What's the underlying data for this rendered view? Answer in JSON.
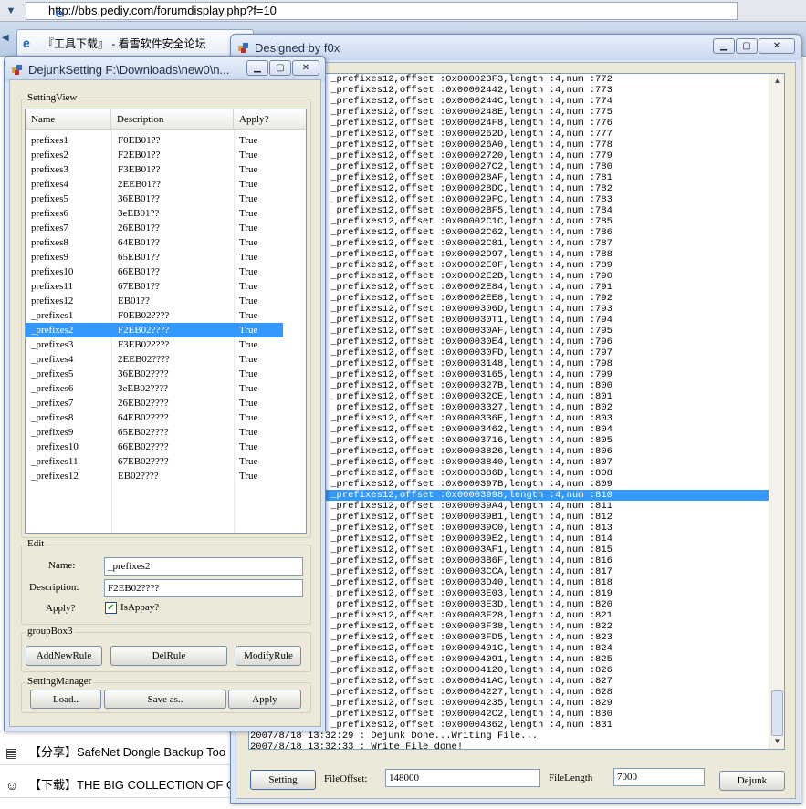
{
  "browser": {
    "url": "http://bbs.pediy.com/forumdisplay.php?f=10",
    "tab_title": "『工具下载』 - 看雪软件安全论坛",
    "rows": [
      {
        "icon": "document-icon",
        "text": "【分享】SafeNet Dongle Backup Too"
      },
      {
        "icon": "smiley-icon",
        "text": "【下载】THE BIG COLLECTION OF O"
      }
    ]
  },
  "main_window": {
    "title": "Designed by f0x",
    "log_lines": [
      "2:29 : Name : _prefixes12,offset :0x000023F3,length :4,num :772",
      "2:29 : Name : _prefixes12,offset :0x00002442,length :4,num :773",
      "2:29 : Name : _prefixes12,offset :0x0000244C,length :4,num :774",
      "2:29 : Name : _prefixes12,offset :0x0000248E,length :4,num :775",
      "2:29 : Name : _prefixes12,offset :0x000024F8,length :4,num :776",
      "2:29 : Name : _prefixes12,offset :0x0000262D,length :4,num :777",
      "2:29 : Name : _prefixes12,offset :0x000026A0,length :4,num :778",
      "2:29 : Name : _prefixes12,offset :0x00002720,length :4,num :779",
      "2:29 : Name : _prefixes12,offset :0x000027C2,length :4,num :780",
      "2:29 : Name : _prefixes12,offset :0x000028AF,length :4,num :781",
      "2:29 : Name : _prefixes12,offset :0x000028DC,length :4,num :782",
      "2:29 : Name : _prefixes12,offset :0x000029FC,length :4,num :783",
      "2:29 : Name : _prefixes12,offset :0x00002BF5,length :4,num :784",
      "2:29 : Name : _prefixes12,offset :0x00002C1C,length :4,num :785",
      "2:29 : Name : _prefixes12,offset :0x00002C62,length :4,num :786",
      "2:29 : Name : _prefixes12,offset :0x00002C81,length :4,num :787",
      "2:29 : Name : _prefixes12,offset :0x00002D97,length :4,num :788",
      "2:29 : Name : _prefixes12,offset :0x00002E0F,length :4,num :789",
      "2:29 : Name : _prefixes12,offset :0x00002E2B,length :4,num :790",
      "2:29 : Name : _prefixes12,offset :0x00002E84,length :4,num :791",
      "2:29 : Name : _prefixes12,offset :0x00002EE8,length :4,num :792",
      "2:29 : Name : _prefixes12,offset :0x0000306D,length :4,num :793",
      "2:29 : Name : _prefixes12,offset :0x000030T1,length :4,num :794",
      "2:29 : Name : _prefixes12,offset :0x000030AF,length :4,num :795",
      "2:29 : Name : _prefixes12,offset :0x000030E4,length :4,num :796",
      "2:29 : Name : _prefixes12,offset :0x000030FD,length :4,num :797",
      "2:29 : Name : _prefixes12,offset :0x00003148,length :4,num :798",
      "2:29 : Name : _prefixes12,offset :0x00003165,length :4,num :799",
      "2:29 : Name : _prefixes12,offset :0x0000327B,length :4,num :800",
      "2:29 : Name : _prefixes12,offset :0x000032CE,length :4,num :801",
      "2:29 : Name : _prefixes12,offset :0x00003327,length :4,num :802",
      "2:29 : Name : _prefixes12,offset :0x0000336E,length :4,num :803",
      "2:29 : Name : _prefixes12,offset :0x00003462,length :4,num :804",
      "2:29 : Name : _prefixes12,offset :0x00003716,length :4,num :805",
      "2:29 : Name : _prefixes12,offset :0x00003826,length :4,num :806",
      "2:29 : Name : _prefixes12,offset :0x00003840,length :4,num :807",
      "2:29 : Name : _prefixes12,offset :0x0000386D,length :4,num :808",
      "2:29 : Name : _prefixes12,offset :0x0000397B,length :4,num :809",
      "2:29 : Name : _prefixes12,offset :0x00003998,length :4,num :810",
      "2:29 : Name : _prefixes12,offset :0x000039A4,length :4,num :811",
      "2:29 : Name : _prefixes12,offset :0x000039B1,length :4,num :812",
      "2:29 : Name : _prefixes12,offset :0x000039C0,length :4,num :813",
      "2:29 : Name : _prefixes12,offset :0x000039E2,length :4,num :814",
      "2:29 : Name : _prefixes12,offset :0x00003AF1,length :4,num :815",
      "2:29 : Name : _prefixes12,offset :0x00003B6F,length :4,num :816",
      "2:29 : Name : _prefixes12,offset :0x00003CCA,length :4,num :817",
      "2:29 : Name : _prefixes12,offset :0x00003D40,length :4,num :818",
      "2:29 : Name : _prefixes12,offset :0x00003E03,length :4,num :819",
      "2:29 : Name : _prefixes12,offset :0x00003E3D,length :4,num :820",
      "2:29 : Name : _prefixes12,offset :0x00003F28,length :4,num :821",
      "2:29 : Name : _prefixes12,offset :0x00003F38,length :4,num :822",
      "2:29 : Name : _prefixes12,offset :0x00003FD5,length :4,num :823",
      "2:29 : Name : _prefixes12,offset :0x0000401C,length :4,num :824",
      "2:29 : Name : _prefixes12,offset :0x00004091,length :4,num :825",
      "2:29 : Name : _prefixes12,offset :0x00004120,length :4,num :826",
      "2:29 : Name : _prefixes12,offset :0x000041AC,length :4,num :827",
      "2:29 : Name : _prefixes12,offset :0x00004227,length :4,num :828",
      "2:29 : Name : _prefixes12,offset :0x00004235,length :4,num :829",
      "2:29 : Name : _prefixes12,offset :0x000042C2,length :4,num :830",
      "2:29 : Name : _prefixes12,offset :0x00004362,length :4,num :831",
      "2007/8/18 13:32:29 : Dejunk Done...Writing File...",
      "2007/8/18 13:32:33 : Write File done!"
    ],
    "selected_log_index": 38,
    "setting_button": "Setting",
    "file_offset_label": "FileOffset:",
    "file_offset_value": "148000",
    "file_length_label": "FileLength",
    "file_length_value": "7000",
    "dejunk_button": "Dejunk"
  },
  "setting_window": {
    "title": "DejunkSetting F:\\Downloads\\new0\\n...",
    "group_title": "SettingView",
    "columns": [
      "Name",
      "Description",
      "Apply?"
    ],
    "rows": [
      {
        "name": "prefixes1",
        "desc": "F0EB01??",
        "apply": "True"
      },
      {
        "name": "prefixes2",
        "desc": "F2EB01??",
        "apply": "True"
      },
      {
        "name": "prefixes3",
        "desc": "F3EB01??",
        "apply": "True"
      },
      {
        "name": "prefixes4",
        "desc": "2EEB01??",
        "apply": "True"
      },
      {
        "name": "prefixes5",
        "desc": "36EB01??",
        "apply": "True"
      },
      {
        "name": "prefixes6",
        "desc": "3eEB01??",
        "apply": "True"
      },
      {
        "name": "prefixes7",
        "desc": "26EB01??",
        "apply": "True"
      },
      {
        "name": "prefixes8",
        "desc": "64EB01??",
        "apply": "True"
      },
      {
        "name": "prefixes9",
        "desc": "65EB01??",
        "apply": "True"
      },
      {
        "name": "prefixes10",
        "desc": "66EB01??",
        "apply": "True"
      },
      {
        "name": "prefixes11",
        "desc": "67EB01??",
        "apply": "True"
      },
      {
        "name": "prefixes12",
        "desc": "EB01??",
        "apply": "True"
      },
      {
        "name": "_prefixes1",
        "desc": "F0EB02????",
        "apply": "True"
      },
      {
        "name": "_prefixes2",
        "desc": "F2EB02????",
        "apply": "True"
      },
      {
        "name": "_prefixes3",
        "desc": "F3EB02????",
        "apply": "True"
      },
      {
        "name": "_prefixes4",
        "desc": "2EEB02????",
        "apply": "True"
      },
      {
        "name": "_prefixes5",
        "desc": "36EB02????",
        "apply": "True"
      },
      {
        "name": "_prefixes6",
        "desc": "3eEB02????",
        "apply": "True"
      },
      {
        "name": "_prefixes7",
        "desc": "26EB02????",
        "apply": "True"
      },
      {
        "name": "_prefixes8",
        "desc": "64EB02????",
        "apply": "True"
      },
      {
        "name": "_prefixes9",
        "desc": "65EB02????",
        "apply": "True"
      },
      {
        "name": "_prefixes10",
        "desc": "66EB02????",
        "apply": "True"
      },
      {
        "name": "_prefixes11",
        "desc": "67EB02????",
        "apply": "True"
      },
      {
        "name": "_prefixes12",
        "desc": "EB02????",
        "apply": "True"
      }
    ],
    "selected_row_index": 13,
    "edit": {
      "group_title": "Edit",
      "name_label": "Name:",
      "name_value": "_prefixes2",
      "desc_label": "Description:",
      "desc_value": "F2EB02????",
      "apply_label": "Apply?",
      "checkbox_label": "IsAppay?",
      "checked": true
    },
    "group3": {
      "title": "groupBox3",
      "add": "AddNewRule",
      "del": "DelRule",
      "modify": "ModifyRule"
    },
    "manager": {
      "title": "SettingManager",
      "load": "Load..",
      "save": "Save as..",
      "apply": "Apply"
    }
  }
}
